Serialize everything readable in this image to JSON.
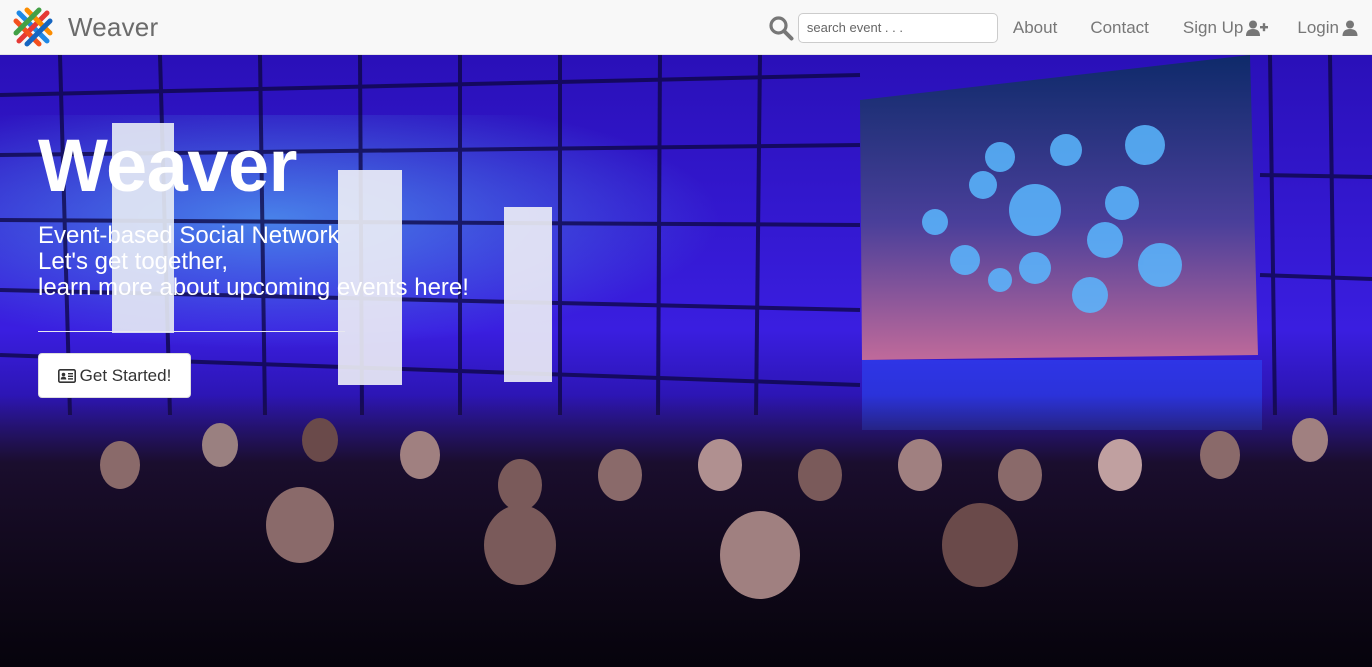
{
  "brand": {
    "name": "Weaver",
    "logo_icon": "weaver-logo-icon"
  },
  "search": {
    "placeholder": "search event . . .",
    "value": "",
    "icon": "search-icon"
  },
  "nav": {
    "about": "About",
    "contact": "Contact",
    "signup": "Sign Up",
    "signup_icon": "user-plus-icon",
    "login": "Login",
    "login_icon": "user-icon"
  },
  "hero": {
    "title": "Weaver",
    "subtitle_lines": [
      "Event-based Social Network",
      "Let's get together,",
      "learn more about upcoming events here!"
    ],
    "cta_label": "Get Started!",
    "cta_icon": "id-card-icon"
  },
  "colors": {
    "navbar_bg": "#f8f8f8",
    "nav_text": "#777777",
    "hero_wall": "#3a18d8",
    "hero_text": "#ffffff"
  }
}
